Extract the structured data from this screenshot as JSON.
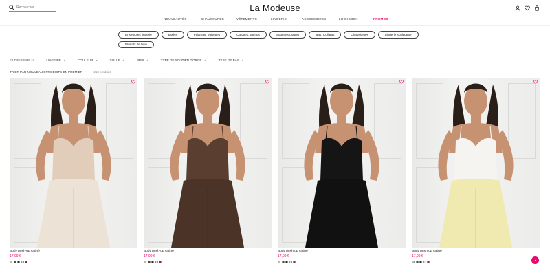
{
  "header": {
    "search_placeholder": "Rechercher",
    "logo": "La Modeuse",
    "nav": [
      "NOUVEAUTÉS",
      "CHAUSSURES",
      "VÊTEMENTS",
      "LINGERIE",
      "ACCESSOIRES",
      "LOOKBOOK",
      "PROMOS"
    ]
  },
  "categories": [
    "Ensembles lingerie",
    "Bodys",
    "Pyjamas, nuisettes",
    "Culottes, Strings",
    "Soutiens-gorges",
    "Bas, Collants",
    "Chaussettes",
    "Lingerie sculptante",
    "Maillots de bain"
  ],
  "filters": {
    "filter_by": "FILTRER PAR",
    "items": [
      "LINGERIE",
      "COULEUR",
      "TAILLE",
      "PRIX",
      "TYPE DE SOUTIEN GORGE",
      "TYPE DE BAS"
    ]
  },
  "sort": {
    "label": "TRIER PAR NOUVEAUX PRODUITS EN PREMIER",
    "count": "210 produits"
  },
  "products": [
    {
      "name": "Body push-up satiné",
      "price": "17,99 €",
      "swatches": [
        "#d9c6b1",
        "#4a3328",
        "#111111",
        "#ffffff",
        "#6b1a2a"
      ],
      "tone": "#e2cdbb",
      "bottom": "#ece3d6"
    },
    {
      "name": "Body push-up satiné",
      "price": "17,99 €",
      "swatches": [
        "#d9c6b1",
        "#4a3328",
        "#111111",
        "#ffffff",
        "#6b1a2a"
      ],
      "tone": "#5a3e2f",
      "bottom": "#4b3427"
    },
    {
      "name": "Body push-up satiné",
      "price": "17,99 €",
      "swatches": [
        "#d9c6b1",
        "#4a3328",
        "#111111",
        "#ffffff",
        "#6b1a2a"
      ],
      "tone": "#151515",
      "bottom": "#111111"
    },
    {
      "name": "Body push-up satiné",
      "price": "17,99 €",
      "swatches": [
        "#d9c6b1",
        "#4a3328",
        "#111111",
        "#ffffff",
        "#6b1a2a"
      ],
      "tone": "#f6f4f0",
      "bottom": "#f0eab0"
    }
  ],
  "colors": {
    "accent": "#e9086e",
    "text": "#1a1a1a",
    "skin": "#c69271",
    "hair": "#2a1e18"
  }
}
